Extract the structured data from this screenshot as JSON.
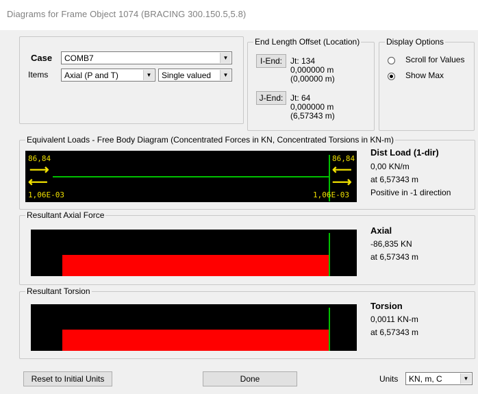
{
  "window": {
    "title": "Diagrams for Frame Object 1074  (BRACING 300.150.5,5.8)"
  },
  "case": {
    "label": "Case",
    "value": "COMB7"
  },
  "items": {
    "label": "Items",
    "value": "Axial (P and T)",
    "mode": "Single valued"
  },
  "end_length": {
    "legend": "End Length Offset (Location)",
    "i_end": {
      "button": "I-End:",
      "jt": "Jt:  134",
      "offset": "0,000000 m",
      "location": "(0,00000 m)"
    },
    "j_end": {
      "button": "J-End:",
      "jt": "Jt:  64",
      "offset": "0,000000 m",
      "location": "(6,57343 m)"
    }
  },
  "display_options": {
    "legend": "Display Options",
    "options": [
      {
        "label": "Scroll for Values",
        "selected": false
      },
      {
        "label": "Show Max",
        "selected": true
      }
    ]
  },
  "fbd": {
    "legend": "Equivalent Loads - Free Body Diagram  (Concentrated Forces in KN, Concentrated Torsions in KN-m)",
    "left_force": "86,84",
    "right_force": "86,84",
    "left_torsion": "1,06E-03",
    "right_torsion": "1,06E-03",
    "info": {
      "title": "Dist Load (1-dir)",
      "value": "0,00 KN/m",
      "at": "at 6,57343 m",
      "note": "Positive in -1 direction"
    }
  },
  "axial": {
    "legend": "Resultant Axial Force",
    "info": {
      "title": "Axial",
      "value": "-86,835 KN",
      "at": "at 6,57343 m"
    }
  },
  "torsion": {
    "legend": "Resultant Torsion",
    "info": {
      "title": "Torsion",
      "value": "0,0011 KN-m",
      "at": "at 6,57343 m"
    }
  },
  "footer": {
    "reset_label": "Reset to Initial Units",
    "done_label": "Done",
    "units_label": "Units",
    "units_value": "KN, m, C"
  },
  "colors": {
    "diagram_fill": "#ff0000",
    "member_line": "#00c000",
    "text_yellow": "#f0e000",
    "diagram_bg": "#000000"
  }
}
